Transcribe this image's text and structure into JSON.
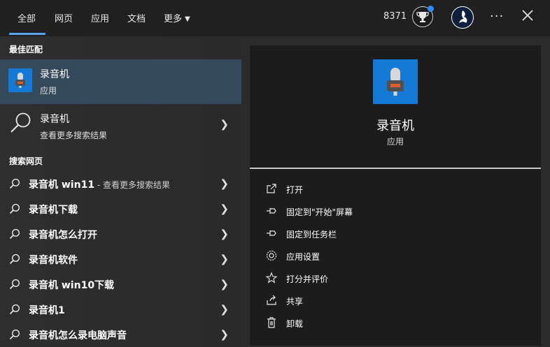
{
  "colors": {
    "accent": "#5aa6ee",
    "app_icon_bg": "#1579d6",
    "selected_bg": "#34495c"
  },
  "header": {
    "tabs": [
      {
        "label": "全部",
        "active": true
      },
      {
        "label": "网页"
      },
      {
        "label": "应用"
      },
      {
        "label": "文档"
      },
      {
        "label": "更多"
      }
    ],
    "points": "8371",
    "icons": [
      "rewards-icon",
      "avatar-icon",
      "more-options-icon",
      "close-icon"
    ]
  },
  "best_match": {
    "section_label": "最佳匹配",
    "title": "录音机",
    "subtitle": "应用"
  },
  "search_more": {
    "title": "录音机",
    "subtitle": "查看更多搜索结果"
  },
  "web": {
    "section_label": "搜索网页",
    "items": [
      {
        "text": "录音机 win11",
        "suffix": " - 查看更多搜索结果"
      },
      {
        "text": "录音机下载"
      },
      {
        "text": "录音机怎么打开"
      },
      {
        "text": "录音机软件"
      },
      {
        "text": "录音机 win10下载"
      },
      {
        "text": "录音机1"
      },
      {
        "text": "录音机怎么录电脑声音"
      }
    ]
  },
  "detail": {
    "title": "录音机",
    "type": "应用",
    "actions": [
      {
        "label": "打开",
        "icon": "open-icon"
      },
      {
        "label": "固定到\"开始\"屏幕",
        "icon": "pin-icon"
      },
      {
        "label": "固定到任务栏",
        "icon": "pin-icon"
      },
      {
        "label": "应用设置",
        "icon": "gear-icon"
      },
      {
        "label": "打分并评价",
        "icon": "star-icon"
      },
      {
        "label": "共享",
        "icon": "share-icon"
      },
      {
        "label": "卸载",
        "icon": "trash-icon"
      }
    ]
  }
}
